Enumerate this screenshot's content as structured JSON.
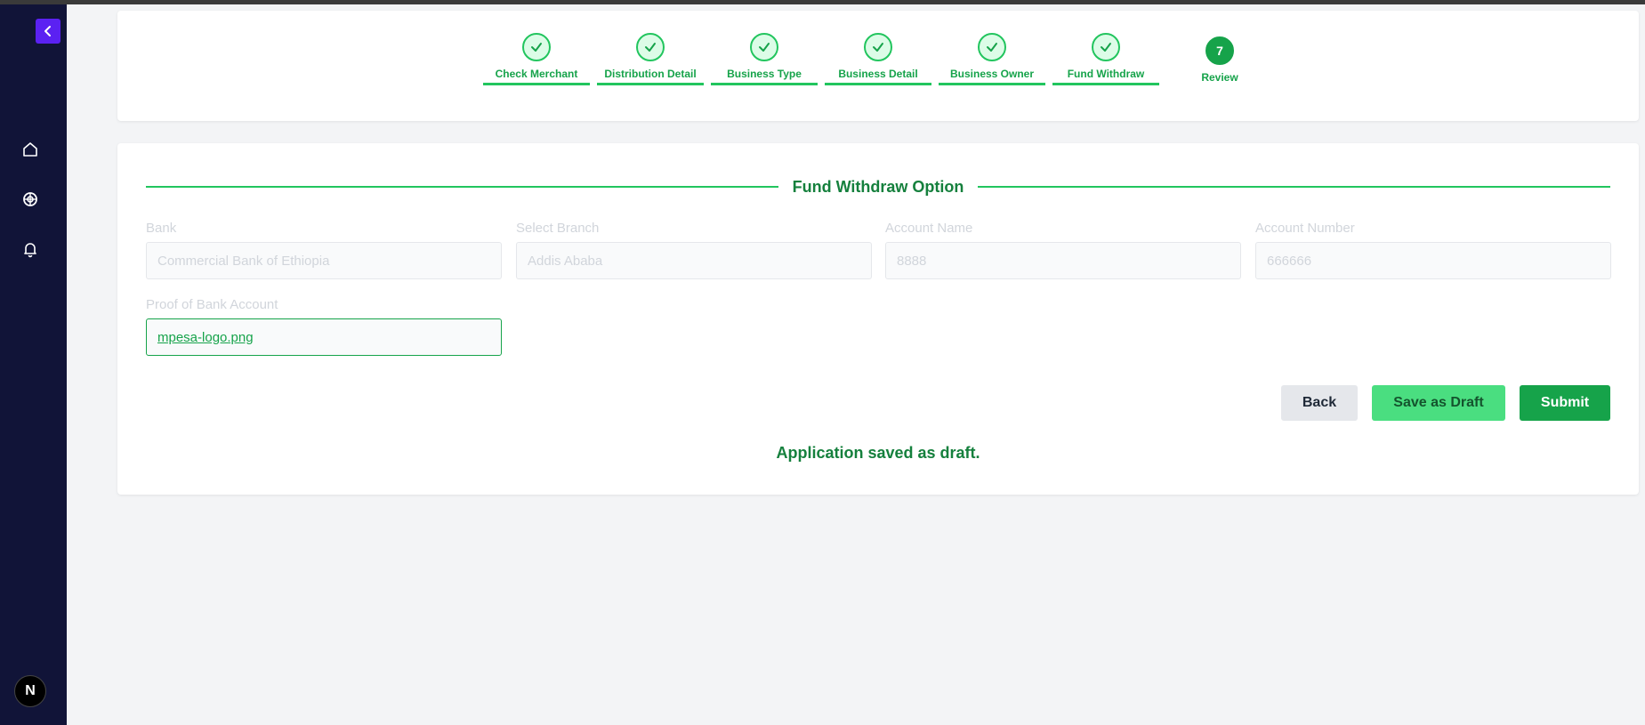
{
  "sidebar": {
    "collapse_icon": "chevron-left-icon",
    "nav_icons": [
      "home-icon",
      "globe-icon",
      "bell-icon"
    ],
    "logo_letter": "N"
  },
  "stepper": {
    "steps": [
      {
        "label": "Check Merchant",
        "status": "complete"
      },
      {
        "label": "Distribution Detail",
        "status": "complete"
      },
      {
        "label": "Business Type",
        "status": "complete"
      },
      {
        "label": "Business Detail",
        "status": "complete"
      },
      {
        "label": "Business Owner",
        "status": "complete"
      },
      {
        "label": "Fund Withdraw",
        "status": "complete"
      },
      {
        "label": "Review",
        "status": "current",
        "number": "7"
      }
    ]
  },
  "form": {
    "section_title": "Fund Withdraw Option",
    "bank": {
      "label": "Bank",
      "value": "Commercial Bank of Ethiopia"
    },
    "branch": {
      "label": "Select Branch",
      "value": "Addis Ababa"
    },
    "account_name": {
      "label": "Account Name",
      "value": "8888"
    },
    "account_number": {
      "label": "Account Number",
      "value": "666666"
    },
    "proof": {
      "label": "Proof of Bank Account",
      "file_name": "mpesa-logo.png"
    }
  },
  "actions": {
    "back_label": "Back",
    "draft_label": "Save as Draft",
    "submit_label": "Submit"
  },
  "status_message": "Application saved as draft.",
  "colors": {
    "sidebar_bg": "#111438",
    "accent_purple": "#5b21f2",
    "success_green": "#16a34a",
    "light_green": "#4ade80"
  }
}
